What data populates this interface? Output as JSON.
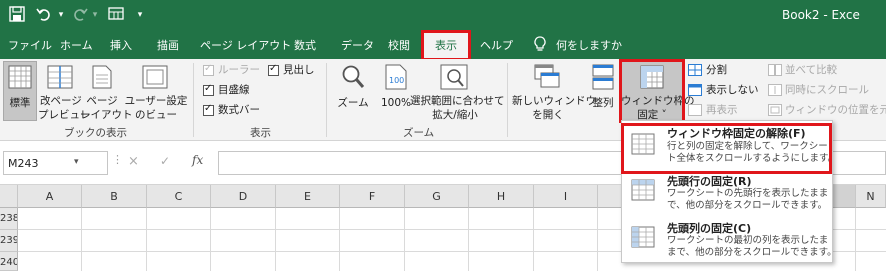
{
  "window": {
    "title": "Book2 - Exce"
  },
  "qat": {
    "save_icon": "save-icon",
    "undo_icon": "undo-icon",
    "redo_icon": "redo-icon",
    "customize_icon": "customize-qat-icon"
  },
  "tabs": [
    {
      "label": "ファイル"
    },
    {
      "label": "ホーム"
    },
    {
      "label": "挿入"
    },
    {
      "label": "描画"
    },
    {
      "label": "ページ レイアウト"
    },
    {
      "label": "数式"
    },
    {
      "label": "データ"
    },
    {
      "label": "校閲"
    },
    {
      "label": "表示"
    },
    {
      "label": "ヘルプ"
    },
    {
      "label": "何をしますか"
    }
  ],
  "ribbon": {
    "workbook_views": {
      "group_label": "ブックの表示",
      "normal": "標準",
      "page_break_1": "改ページ",
      "page_break_2": "プレビュー",
      "page_layout_1": "ページ",
      "page_layout_2": "レイアウト",
      "custom_1": "ユーザー設定",
      "custom_2": "のビュー"
    },
    "show": {
      "group_label": "表示",
      "ruler": "ルーラー",
      "gridlines": "目盛線",
      "formula_bar": "数式バー",
      "headings": "見出し"
    },
    "zoom": {
      "group_label": "ズーム",
      "zoom": "ズーム",
      "hundred": "100%",
      "fit_1": "選択範囲に合わせて",
      "fit_2": "拡大/縮小"
    },
    "window": {
      "new_window_1": "新しいウィンドウ",
      "new_window_2": "を開く",
      "arrange": "整列",
      "freeze_1": "ウィンドウ枠の",
      "freeze_2": "固定 ˅",
      "split": "分割",
      "hide": "表示しない",
      "unhide": "再表示",
      "side_by_side": "並べて比較",
      "sync_scroll": "同時にスクロール",
      "reset_pos": "ウィンドウの位置を元に戻"
    }
  },
  "formula_bar": {
    "name_box": "M243",
    "cancel": "×",
    "enter": "✓",
    "fx": "fx",
    "value": ""
  },
  "grid": {
    "columns": [
      "A",
      "B",
      "C",
      "D",
      "E",
      "F",
      "G",
      "H",
      "I",
      "J",
      "K",
      "L",
      "M",
      "N"
    ],
    "rows": [
      "238",
      "239",
      "240"
    ]
  },
  "freeze_menu": {
    "items": [
      {
        "title": "ウィンドウ枠固定の解除(F)",
        "desc1": "行と列の固定を解除して、ワークシー",
        "desc2": "ト全体をスクロールするようにします。"
      },
      {
        "title": "先頭行の固定(R)",
        "desc1": "ワークシートの先頭行を表示したまま",
        "desc2": "で、他の部分をスクロールできます。"
      },
      {
        "title": "先頭列の固定(C)",
        "desc1": "ワークシートの最初の列を表示したま",
        "desc2": "まで、他の部分をスクロールできます。"
      }
    ]
  },
  "colors": {
    "excel_green": "#217346",
    "highlight_red": "#e0161b",
    "ribbon_bg": "#f3f3f3"
  }
}
